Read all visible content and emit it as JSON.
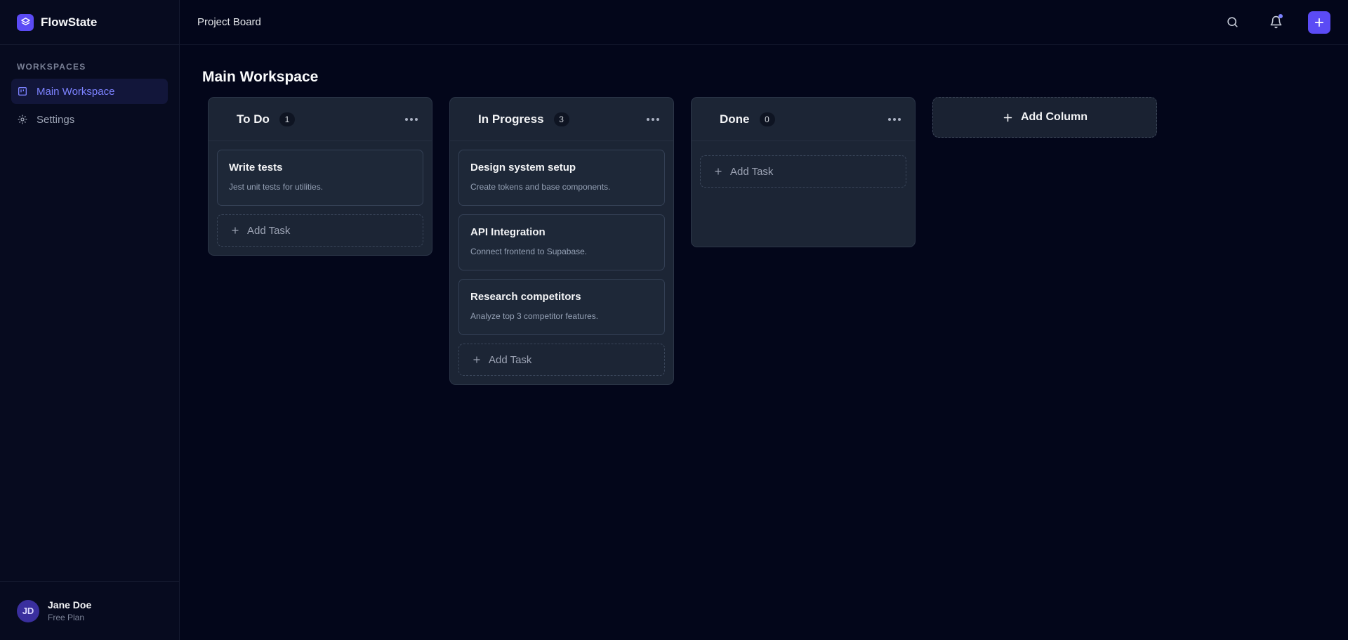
{
  "brand": {
    "name": "FlowState",
    "accent": "#5b4bf5"
  },
  "sidebar": {
    "heading": "WORKSPACES",
    "items": [
      {
        "label": "Main Workspace",
        "icon": "board-icon",
        "active": true
      },
      {
        "label": "Settings",
        "icon": "gear-icon",
        "active": false
      }
    ]
  },
  "user": {
    "initials": "JD",
    "name": "Jane Doe",
    "plan": "Free Plan"
  },
  "topbar": {
    "title": "Project Board",
    "icons": [
      "search-icon",
      "bell-icon",
      "plus-icon"
    ]
  },
  "page": {
    "title": "Main Workspace"
  },
  "columns": [
    {
      "title": "To Do",
      "count": "1",
      "cards": [
        {
          "title": "Write tests",
          "desc": "Jest unit tests for utilities."
        }
      ],
      "add_label": "Add Task"
    },
    {
      "title": "In Progress",
      "count": "3",
      "cards": [
        {
          "title": "Design system setup",
          "desc": "Create tokens and base components."
        },
        {
          "title": "API Integration",
          "desc": "Connect frontend to Supabase."
        },
        {
          "title": "Research competitors",
          "desc": "Analyze top 3 competitor features."
        }
      ],
      "add_label": "Add Task"
    },
    {
      "title": "Done",
      "count": "0",
      "cards": [],
      "add_label": "Add Task"
    }
  ],
  "add_column_label": "Add Column"
}
